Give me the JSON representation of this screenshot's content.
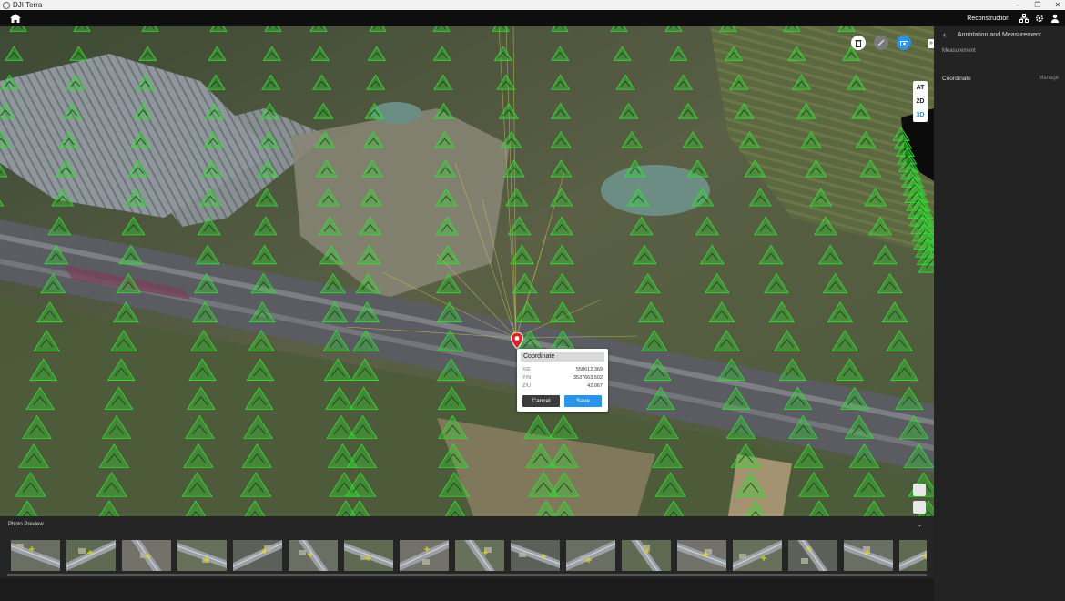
{
  "window": {
    "app_title": "DJI Terra"
  },
  "topnav": {
    "mode_label": "Reconstruction"
  },
  "viewport": {
    "modes": [
      "AT",
      "2D",
      "3D"
    ],
    "active_mode": "3D",
    "tools": [
      "delete-icon",
      "edit-icon",
      "camera-icon"
    ],
    "bottom_tools": [
      "layers-icon",
      "legend-icon"
    ]
  },
  "coordinate_popup": {
    "title": "Coordinate",
    "rows": [
      {
        "label": "X/E",
        "value": "550612.369"
      },
      {
        "label": "Y/N",
        "value": "3537663.502"
      },
      {
        "label": "Z/U",
        "value": "42.067"
      }
    ],
    "cancel_label": "Cancel",
    "save_label": "Save"
  },
  "right_panel": {
    "title": "Annotation and Measurement",
    "section_label": "Measurement",
    "tool_icons": [
      "point-icon",
      "line-icon",
      "area-icon",
      "volume-icon"
    ],
    "coordinate_label": "Coordinate",
    "manage_label": "Manage"
  },
  "photo_preview": {
    "title": "Photo Preview",
    "thumbnail_count": 17
  },
  "colors": {
    "accent": "#2a95e8",
    "camera_frustum": "#33dd33",
    "pin": "#d6262e"
  }
}
